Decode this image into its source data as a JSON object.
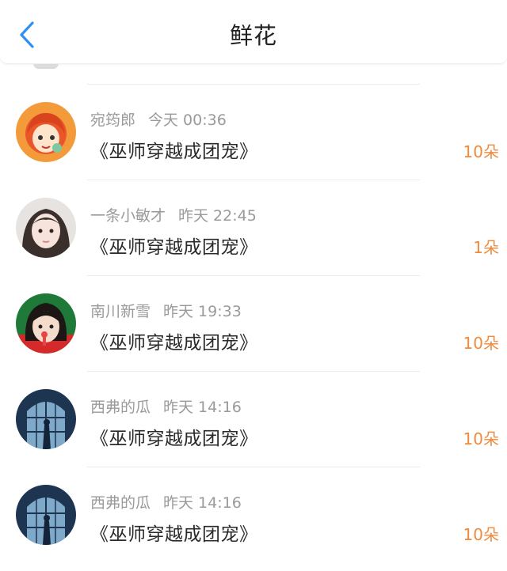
{
  "header": {
    "back_icon": "chevron-left-icon",
    "title": "鲜花"
  },
  "colors": {
    "accent": "#2f8ff5",
    "count": "#f08a3c"
  },
  "gifts": [
    {
      "name": "宛筠郎",
      "time": "今天 00:36",
      "book": "《巫师穿越成团宠》",
      "count": "10朵"
    },
    {
      "name": "一条小敏才",
      "time": "昨天 22:45",
      "book": "《巫师穿越成团宠》",
      "count": "1朵"
    },
    {
      "name": "南川新雪",
      "time": "昨天 19:33",
      "book": "《巫师穿越成团宠》",
      "count": "10朵"
    },
    {
      "name": "西弗的瓜",
      "time": "昨天 14:16",
      "book": "《巫师穿越成团宠》",
      "count": "10朵"
    },
    {
      "name": "西弗的瓜",
      "time": "昨天 14:16",
      "book": "《巫师穿越成团宠》",
      "count": "10朵"
    }
  ]
}
